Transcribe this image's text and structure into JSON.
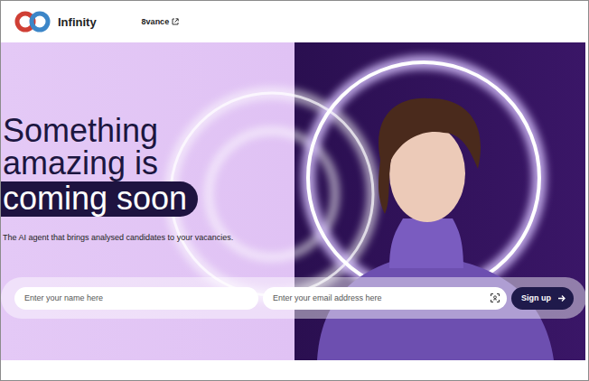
{
  "header": {
    "logo_text": "Infinity",
    "link": {
      "label": "8vance"
    }
  },
  "hero": {
    "heading_lines": [
      "Something",
      "amazing is"
    ],
    "highlight": "coming soon",
    "subtitle": "The AI agent that brings analysed candidates to your vacancies."
  },
  "form": {
    "name_placeholder": "Enter your name here",
    "email_placeholder": "Enter your email address here",
    "button": "Sign up"
  }
}
